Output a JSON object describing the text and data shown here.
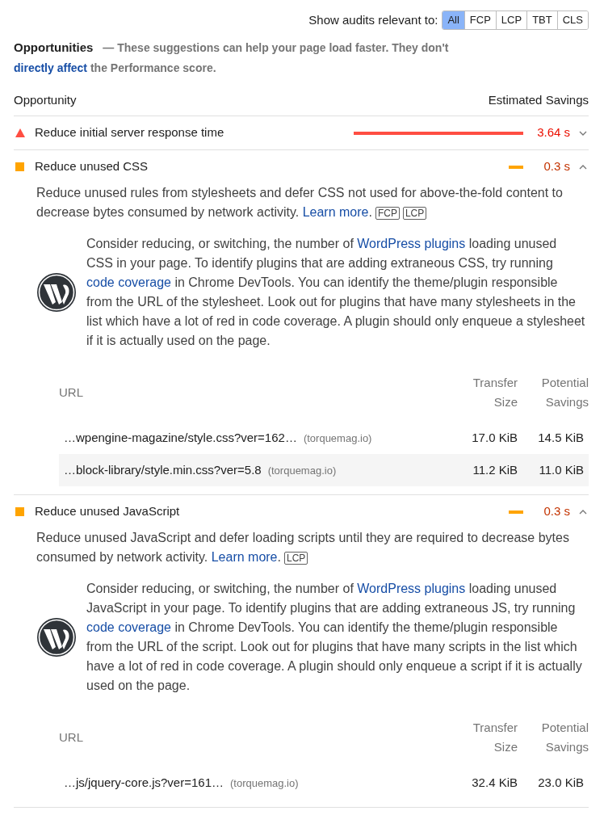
{
  "filter": {
    "label": "Show audits relevant to:",
    "options": [
      {
        "label": "All",
        "selected": true
      },
      {
        "label": "FCP",
        "selected": false
      },
      {
        "label": "LCP",
        "selected": false
      },
      {
        "label": "TBT",
        "selected": false
      },
      {
        "label": "CLS",
        "selected": false
      }
    ]
  },
  "section": {
    "title": "Opportunities",
    "dash": "—",
    "description": [
      {
        "text": "These suggestions can help your page load faster. They don't "
      },
      {
        "link": "directly affect"
      },
      {
        "text": " the Performance score."
      }
    ]
  },
  "columns": {
    "opportunity": "Opportunity",
    "savings": "Estimated Savings"
  },
  "audits": [
    {
      "kind": "fail",
      "title": "Reduce initial server response time",
      "savings": "3.64 s",
      "expanded": false
    },
    {
      "kind": "average",
      "title": "Reduce unused CSS",
      "savings": "0.3 s",
      "expanded": true,
      "description": [
        {
          "text": "Reduce unused rules from stylesheets and defer CSS not used for above-the-fold content to decrease bytes consumed by network activity. "
        },
        {
          "link": "Learn more"
        },
        {
          "text": "."
        }
      ],
      "metrics": [
        "FCP",
        "LCP"
      ],
      "note": [
        {
          "text": "Consider reducing, or switching, the number of "
        },
        {
          "link": "WordPress plugins"
        },
        {
          "text": " loading unused CSS in your page. To identify plugins that are adding extraneous CSS, try running "
        },
        {
          "link": "code coverage"
        },
        {
          "text": " in Chrome DevTools. You can identify the theme/plugin responsible from the URL of the stylesheet. Look out for plugins that have many stylesheets in the list which have a lot of red in code coverage. A plugin should only enqueue a stylesheet if it is actually used on the page."
        }
      ],
      "table": {
        "columns": [
          "URL",
          "Transfer Size",
          "Potential Savings"
        ],
        "rows": [
          {
            "url": "…wpengine-magazine/style.css?ver=162…",
            "host": "(torquemag.io)",
            "transfer": "17.0 KiB",
            "savings": "14.5 KiB"
          },
          {
            "url": "…block-library/style.min.css?ver=5.8",
            "host": "(torquemag.io)",
            "transfer": "11.2 KiB",
            "savings": "11.0 KiB"
          }
        ]
      }
    },
    {
      "kind": "average",
      "title": "Reduce unused JavaScript",
      "savings": "0.3 s",
      "expanded": true,
      "description": [
        {
          "text": "Reduce unused JavaScript and defer loading scripts until they are required to decrease bytes consumed by network activity. "
        },
        {
          "link": "Learn more"
        },
        {
          "text": "."
        }
      ],
      "metrics": [
        "LCP"
      ],
      "note": [
        {
          "text": "Consider reducing, or switching, the number of "
        },
        {
          "link": "WordPress plugins"
        },
        {
          "text": " loading unused JavaScript in your page. To identify plugins that are adding extraneous JS, try running "
        },
        {
          "link": "code coverage"
        },
        {
          "text": " in Chrome DevTools. You can identify the theme/plugin responsible from the URL of the script. Look out for plugins that have many scripts in the list which have a lot of red in code coverage. A plugin should only enqueue a script if it is actually used on the page."
        }
      ],
      "table": {
        "columns": [
          "URL",
          "Transfer Size",
          "Potential Savings"
        ],
        "rows": [
          {
            "url": "…js/jquery-core.js?ver=161…",
            "host": "(torquemag.io)",
            "transfer": "32.4 KiB",
            "savings": "23.0 KiB"
          }
        ]
      }
    }
  ]
}
